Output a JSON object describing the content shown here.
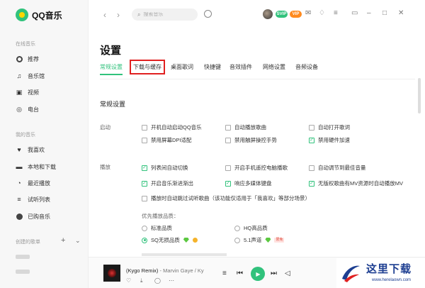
{
  "app": {
    "name": "QQ音乐"
  },
  "sidebar": {
    "online_section": "在线音乐",
    "online_items": [
      {
        "label": "推荐",
        "icon": "compass-icon"
      },
      {
        "label": "音乐馆",
        "icon": "music-note-icon"
      },
      {
        "label": "视频",
        "icon": "video-icon"
      },
      {
        "label": "电台",
        "icon": "radio-icon"
      }
    ],
    "my_section": "我的音乐",
    "my_items": [
      {
        "label": "我喜欢",
        "icon": "heart-icon"
      },
      {
        "label": "本地和下载",
        "icon": "computer-icon"
      },
      {
        "label": "最近播放",
        "icon": "clock-icon"
      },
      {
        "label": "试听列表",
        "icon": "list-icon"
      },
      {
        "label": "已购音乐",
        "icon": "check-circle-icon"
      }
    ],
    "created_section": "创建的歌单",
    "add_icon": "plus-icon",
    "expand_icon": "chevron-down-icon"
  },
  "topbar": {
    "search_placeholder": "搜索音乐",
    "badges": [
      {
        "text": "SVIP",
        "color": "#31c27c"
      },
      {
        "text": "VIP",
        "color": "#ff8a1e"
      }
    ]
  },
  "settings": {
    "title": "设置",
    "tabs": [
      {
        "label": "常规设置",
        "active": true
      },
      {
        "label": "下载与缓存",
        "highlighted": true
      },
      {
        "label": "桌面歌词"
      },
      {
        "label": "快捷键"
      },
      {
        "label": "音效插件"
      },
      {
        "label": "网络设置"
      },
      {
        "label": "音频设备"
      }
    ],
    "section_title": "常规设置",
    "startup": {
      "label": "启动",
      "options": [
        {
          "label": "开机自动启动QQ音乐",
          "checked": false
        },
        {
          "label": "自动播放歌曲",
          "checked": false
        },
        {
          "label": "自动打开歌词",
          "checked": false
        },
        {
          "label": "禁用屏幕DPI适配",
          "checked": false
        },
        {
          "label": "禁用触屏操控手势",
          "checked": false
        },
        {
          "label": "禁用硬件加速",
          "checked": true
        }
      ]
    },
    "playback": {
      "label": "播放",
      "options": [
        {
          "label": "列表间自动切换",
          "checked": true
        },
        {
          "label": "开启手机遥控电脑播歌",
          "checked": false
        },
        {
          "label": "自动调节到最佳音量",
          "checked": false
        },
        {
          "label": "开启音乐渐进渐出",
          "checked": true
        },
        {
          "label": "响应多媒体键盘",
          "checked": true
        },
        {
          "label": "无版权歌曲有MV资源时自动播放MV",
          "checked": true
        },
        {
          "label": "播放时自动跳过试听歌曲（该功能仅适用于「我喜欢」等部分场景）",
          "checked": false
        }
      ]
    },
    "quality": {
      "label": "优先播放品质：",
      "options": [
        {
          "label": "标准品质",
          "selected": false
        },
        {
          "label": "HQ高品质",
          "selected": false
        },
        {
          "label": "SQ无损品质",
          "selected": true
        },
        {
          "label": "5.1声道",
          "selected": false,
          "tag": "限免"
        }
      ]
    }
  },
  "player": {
    "title": "(Kygo Remix)",
    "artist": " - Marvin Gaye / Ky"
  },
  "watermark": {
    "title": "这里下载",
    "url": "www.herelaown.com"
  },
  "colors": {
    "accent": "#31c27c",
    "highlight_box": "#e02020",
    "watermark": "#1d3e91"
  }
}
